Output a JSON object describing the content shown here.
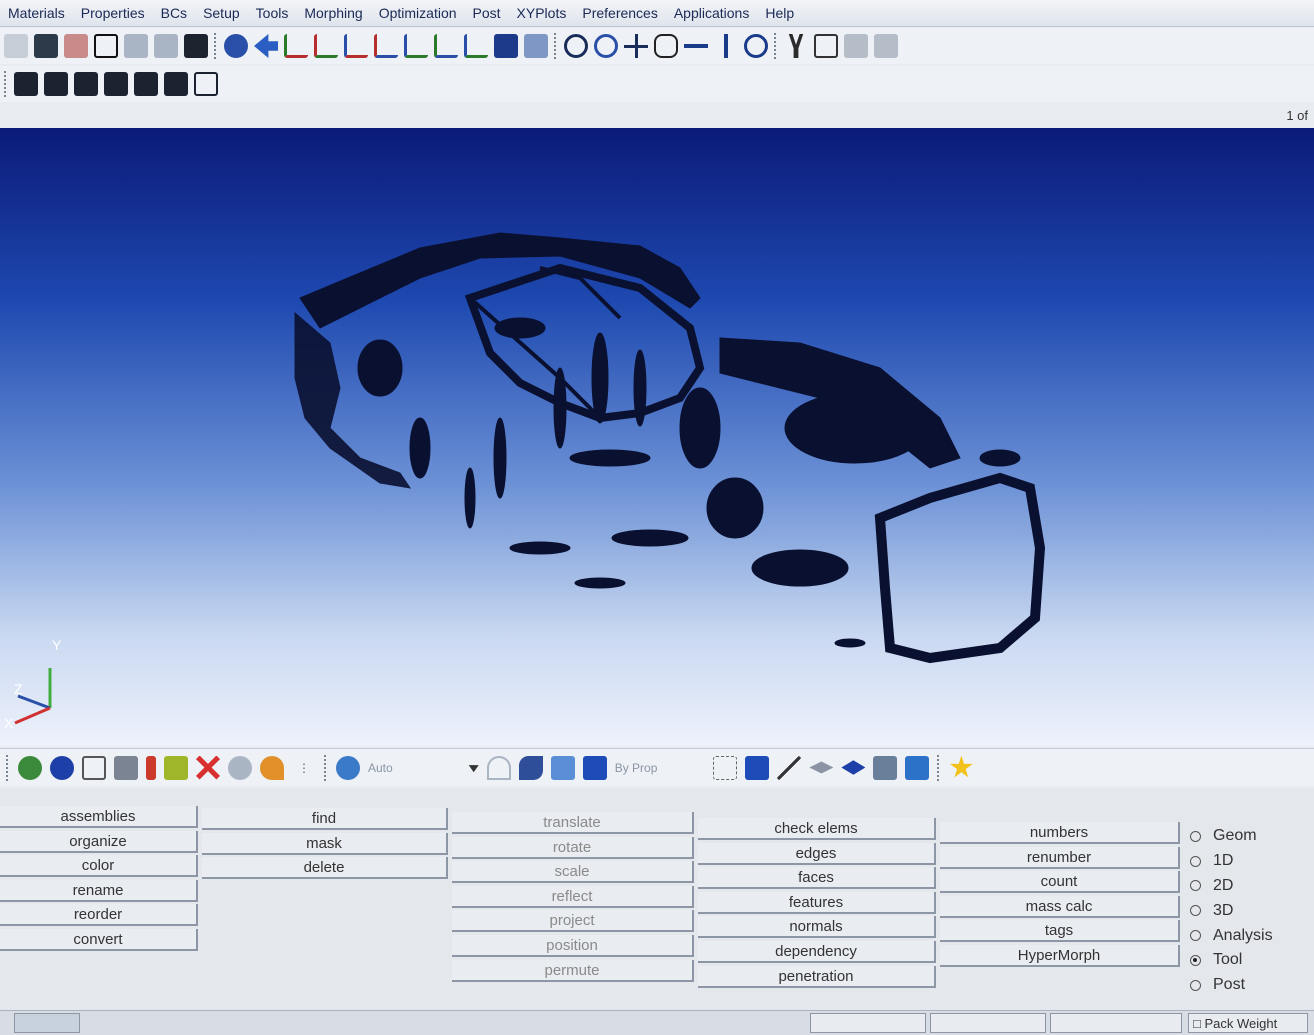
{
  "menu": {
    "items": [
      "Materials",
      "Properties",
      "BCs",
      "Setup",
      "Tools",
      "Morphing",
      "Optimization",
      "Post",
      "XYPlots",
      "Preferences",
      "Applications",
      "Help"
    ]
  },
  "page_indicator": "1 of",
  "viewport": {
    "axis_labels": {
      "y": "Y",
      "z": "Z",
      "x": "X"
    }
  },
  "bottom_toolbar": {
    "auto_label": "Auto",
    "by_prop_label": "By Prop"
  },
  "panel": {
    "col1": [
      "assemblies",
      "organize",
      "color",
      "rename",
      "reorder",
      "convert"
    ],
    "col2": [
      "find",
      "mask",
      "delete"
    ],
    "col3": [
      "translate",
      "rotate",
      "scale",
      "reflect",
      "project",
      "position",
      "permute"
    ],
    "col4": [
      "check elems",
      "edges",
      "faces",
      "features",
      "normals",
      "dependency",
      "penetration"
    ],
    "col5": [
      "numbers",
      "renumber",
      "count",
      "mass calc",
      "tags",
      "HyperMorph"
    ],
    "radios": [
      "Geom",
      "1D",
      "2D",
      "3D",
      "Analysis",
      "Tool",
      "Post"
    ],
    "selected_radio": "Tool"
  },
  "status": {
    "pack_weight": "Pack Weight"
  },
  "colors": {
    "viewport_top": "#0b1a78",
    "viewport_bottom": "#eef2fb",
    "mesh": "#0a1030"
  }
}
